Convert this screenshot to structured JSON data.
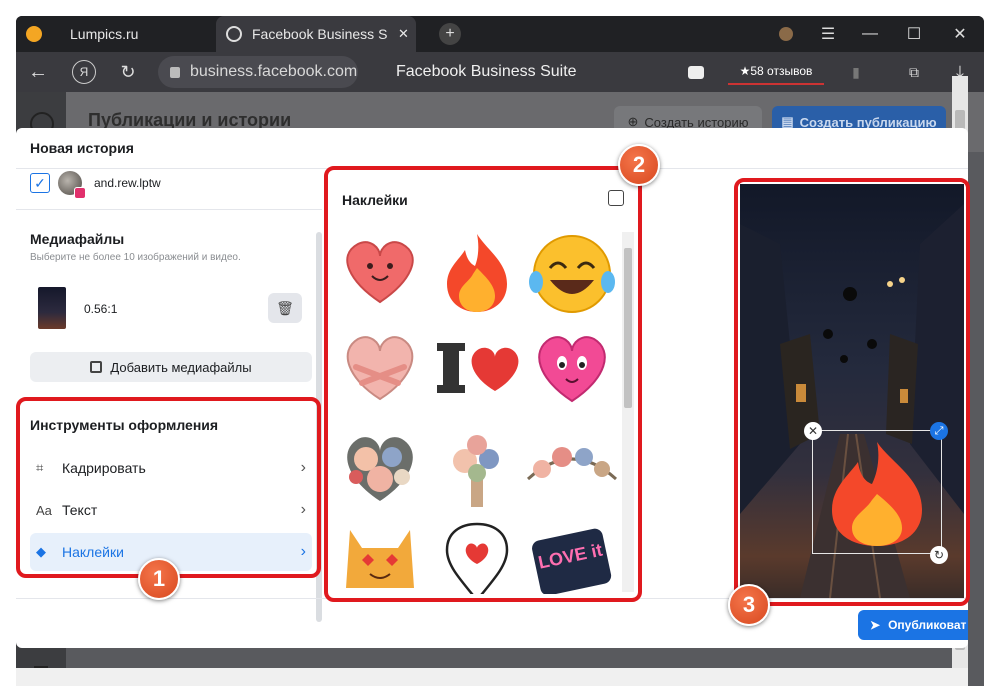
{
  "browser": {
    "tabs": [
      {
        "label": "Lumpics.ru"
      },
      {
        "label": "Facebook Business Suite",
        "close": "✕"
      }
    ],
    "new_tab": "+",
    "address": "business.facebook.com",
    "page_title": "Facebook Business Suite",
    "reviews": "★58 отзывов",
    "nav_icons": [
      "back-icon",
      "yandex-icon",
      "reload-icon",
      "lock-icon"
    ],
    "window_controls": [
      "extension-icon",
      "menu-icon",
      "minimize-icon",
      "maximize-icon",
      "close-icon"
    ],
    "colors": {
      "tabbar": "#202124",
      "toolbar": "#3a3a3f"
    }
  },
  "background_page": {
    "title": "Публикации и истории",
    "create_story": "Создать историю",
    "create_post": "Создать публикацию"
  },
  "modal": {
    "header": "Новая история",
    "account": {
      "name": "and.rew.lptw",
      "checked": true
    },
    "media": {
      "title": "Медиафайлы",
      "hint": "Выберите не более 10 изображений и видео.",
      "item_ratio": "0.56:1",
      "add_button": "Добавить медиафайлы"
    },
    "tools": {
      "title": "Инструменты оформления",
      "items": [
        {
          "label": "Кадрировать",
          "icon": "crop-icon",
          "icon_glyph": "⌗"
        },
        {
          "label": "Текст",
          "icon": "text-icon",
          "icon_glyph": "Aa"
        },
        {
          "label": "Наклейки",
          "icon": "sticker-icon",
          "icon_glyph": "◆",
          "active": true
        }
      ]
    },
    "stickers": {
      "title": "Наклейки",
      "items": [
        "smiling-heart",
        "fire",
        "laughing-tears",
        "hugging-heart",
        "i-love",
        "pink-heart-face",
        "flower-heart",
        "flower-bouquet",
        "flower-wreath",
        "heart-eyes-cat",
        "heart-pin",
        "love-it"
      ],
      "love_it_text": "LOVE it"
    },
    "publish": "Опубликоват"
  },
  "markers": [
    "1",
    "2",
    "3"
  ],
  "accent_colors": {
    "primary": "#1b74e4",
    "highlight": "#e0191e"
  }
}
